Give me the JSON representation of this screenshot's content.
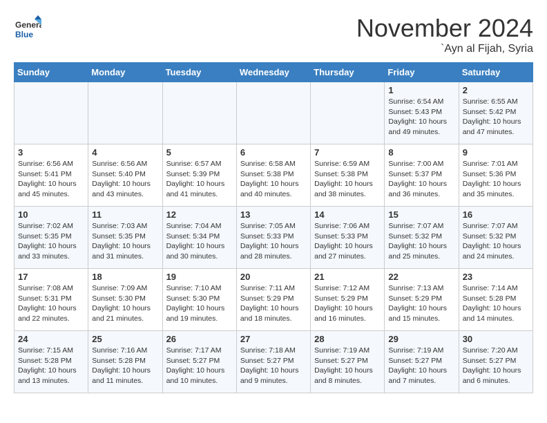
{
  "logo": {
    "text_general": "General",
    "text_blue": "Blue"
  },
  "title": "November 2024",
  "location": "`Ayn al Fijah, Syria",
  "headers": [
    "Sunday",
    "Monday",
    "Tuesday",
    "Wednesday",
    "Thursday",
    "Friday",
    "Saturday"
  ],
  "weeks": [
    [
      {
        "day": "",
        "info": ""
      },
      {
        "day": "",
        "info": ""
      },
      {
        "day": "",
        "info": ""
      },
      {
        "day": "",
        "info": ""
      },
      {
        "day": "",
        "info": ""
      },
      {
        "day": "1",
        "info": "Sunrise: 6:54 AM\nSunset: 5:43 PM\nDaylight: 10 hours\nand 49 minutes."
      },
      {
        "day": "2",
        "info": "Sunrise: 6:55 AM\nSunset: 5:42 PM\nDaylight: 10 hours\nand 47 minutes."
      }
    ],
    [
      {
        "day": "3",
        "info": "Sunrise: 6:56 AM\nSunset: 5:41 PM\nDaylight: 10 hours\nand 45 minutes."
      },
      {
        "day": "4",
        "info": "Sunrise: 6:56 AM\nSunset: 5:40 PM\nDaylight: 10 hours\nand 43 minutes."
      },
      {
        "day": "5",
        "info": "Sunrise: 6:57 AM\nSunset: 5:39 PM\nDaylight: 10 hours\nand 41 minutes."
      },
      {
        "day": "6",
        "info": "Sunrise: 6:58 AM\nSunset: 5:38 PM\nDaylight: 10 hours\nand 40 minutes."
      },
      {
        "day": "7",
        "info": "Sunrise: 6:59 AM\nSunset: 5:38 PM\nDaylight: 10 hours\nand 38 minutes."
      },
      {
        "day": "8",
        "info": "Sunrise: 7:00 AM\nSunset: 5:37 PM\nDaylight: 10 hours\nand 36 minutes."
      },
      {
        "day": "9",
        "info": "Sunrise: 7:01 AM\nSunset: 5:36 PM\nDaylight: 10 hours\nand 35 minutes."
      }
    ],
    [
      {
        "day": "10",
        "info": "Sunrise: 7:02 AM\nSunset: 5:35 PM\nDaylight: 10 hours\nand 33 minutes."
      },
      {
        "day": "11",
        "info": "Sunrise: 7:03 AM\nSunset: 5:35 PM\nDaylight: 10 hours\nand 31 minutes."
      },
      {
        "day": "12",
        "info": "Sunrise: 7:04 AM\nSunset: 5:34 PM\nDaylight: 10 hours\nand 30 minutes."
      },
      {
        "day": "13",
        "info": "Sunrise: 7:05 AM\nSunset: 5:33 PM\nDaylight: 10 hours\nand 28 minutes."
      },
      {
        "day": "14",
        "info": "Sunrise: 7:06 AM\nSunset: 5:33 PM\nDaylight: 10 hours\nand 27 minutes."
      },
      {
        "day": "15",
        "info": "Sunrise: 7:07 AM\nSunset: 5:32 PM\nDaylight: 10 hours\nand 25 minutes."
      },
      {
        "day": "16",
        "info": "Sunrise: 7:07 AM\nSunset: 5:32 PM\nDaylight: 10 hours\nand 24 minutes."
      }
    ],
    [
      {
        "day": "17",
        "info": "Sunrise: 7:08 AM\nSunset: 5:31 PM\nDaylight: 10 hours\nand 22 minutes."
      },
      {
        "day": "18",
        "info": "Sunrise: 7:09 AM\nSunset: 5:30 PM\nDaylight: 10 hours\nand 21 minutes."
      },
      {
        "day": "19",
        "info": "Sunrise: 7:10 AM\nSunset: 5:30 PM\nDaylight: 10 hours\nand 19 minutes."
      },
      {
        "day": "20",
        "info": "Sunrise: 7:11 AM\nSunset: 5:29 PM\nDaylight: 10 hours\nand 18 minutes."
      },
      {
        "day": "21",
        "info": "Sunrise: 7:12 AM\nSunset: 5:29 PM\nDaylight: 10 hours\nand 16 minutes."
      },
      {
        "day": "22",
        "info": "Sunrise: 7:13 AM\nSunset: 5:29 PM\nDaylight: 10 hours\nand 15 minutes."
      },
      {
        "day": "23",
        "info": "Sunrise: 7:14 AM\nSunset: 5:28 PM\nDaylight: 10 hours\nand 14 minutes."
      }
    ],
    [
      {
        "day": "24",
        "info": "Sunrise: 7:15 AM\nSunset: 5:28 PM\nDaylight: 10 hours\nand 13 minutes."
      },
      {
        "day": "25",
        "info": "Sunrise: 7:16 AM\nSunset: 5:28 PM\nDaylight: 10 hours\nand 11 minutes."
      },
      {
        "day": "26",
        "info": "Sunrise: 7:17 AM\nSunset: 5:27 PM\nDaylight: 10 hours\nand 10 minutes."
      },
      {
        "day": "27",
        "info": "Sunrise: 7:18 AM\nSunset: 5:27 PM\nDaylight: 10 hours\nand 9 minutes."
      },
      {
        "day": "28",
        "info": "Sunrise: 7:19 AM\nSunset: 5:27 PM\nDaylight: 10 hours\nand 8 minutes."
      },
      {
        "day": "29",
        "info": "Sunrise: 7:19 AM\nSunset: 5:27 PM\nDaylight: 10 hours\nand 7 minutes."
      },
      {
        "day": "30",
        "info": "Sunrise: 7:20 AM\nSunset: 5:27 PM\nDaylight: 10 hours\nand 6 minutes."
      }
    ]
  ]
}
